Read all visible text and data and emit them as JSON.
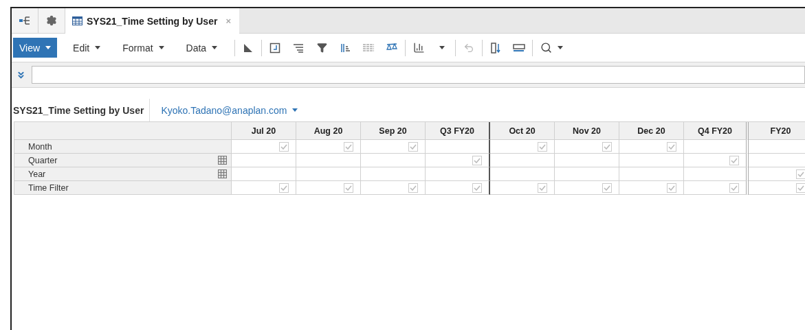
{
  "tabs": [
    {
      "label": "SYS21_Time Setting by User",
      "selected": true,
      "close": "×"
    }
  ],
  "menus": [
    {
      "label": "View",
      "selected": true
    },
    {
      "label": "Edit",
      "selected": false
    },
    {
      "label": "Format",
      "selected": false
    },
    {
      "label": "Data",
      "selected": false
    }
  ],
  "module": {
    "title": "SYS21_Time Setting by User",
    "user": "Kyoko.Tadano@anaplan.com"
  },
  "grid": {
    "columns": [
      {
        "label": "Jul 20",
        "kind": "month"
      },
      {
        "label": "Aug 20",
        "kind": "month"
      },
      {
        "label": "Sep 20",
        "kind": "month"
      },
      {
        "label": "Q3 FY20",
        "kind": "quarter"
      },
      {
        "label": "Oct 20",
        "kind": "month"
      },
      {
        "label": "Nov 20",
        "kind": "month"
      },
      {
        "label": "Dec 20",
        "kind": "month"
      },
      {
        "label": "Q4 FY20",
        "kind": "year-end"
      },
      {
        "label": "FY20",
        "kind": "year"
      }
    ],
    "rows": [
      {
        "label": "Month",
        "subsidiary": false,
        "cells": [
          true,
          true,
          true,
          false,
          true,
          true,
          true,
          false,
          false
        ]
      },
      {
        "label": "Quarter",
        "subsidiary": true,
        "cells": [
          false,
          false,
          false,
          true,
          false,
          false,
          false,
          true,
          false
        ]
      },
      {
        "label": "Year",
        "subsidiary": true,
        "cells": [
          false,
          false,
          false,
          false,
          false,
          false,
          false,
          false,
          true
        ]
      },
      {
        "label": "Time Filter",
        "subsidiary": false,
        "cells": [
          true,
          true,
          true,
          true,
          true,
          true,
          true,
          true,
          true
        ]
      }
    ]
  }
}
